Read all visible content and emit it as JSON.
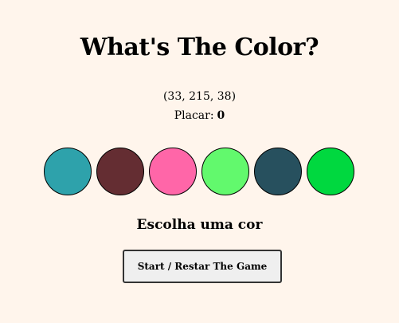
{
  "title": "What's The Color?",
  "target_rgb": "(33, 215, 38)",
  "score": {
    "label": "Placar:",
    "value": "0"
  },
  "circles": [
    {
      "color": "#2ea2ab"
    },
    {
      "color": "#642d32"
    },
    {
      "color": "#ff66a8"
    },
    {
      "color": "#62f96d"
    },
    {
      "color": "#27505e"
    },
    {
      "color": "#00d83f"
    }
  ],
  "message": "Escolha uma cor",
  "button_label": "Start / Restar The Game"
}
